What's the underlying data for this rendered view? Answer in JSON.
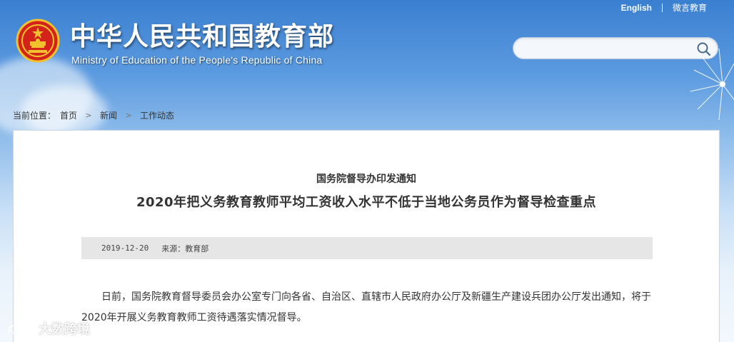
{
  "header": {
    "title": "中华人民共和国教育部",
    "subtitle": "Ministry of Education of the People's Republic of China",
    "links": {
      "english": "English",
      "weibo": "微言教育"
    },
    "search": {
      "placeholder": ""
    }
  },
  "breadcrumb": {
    "prefix": "当前位置：",
    "items": [
      "首页",
      "新闻",
      "工作动态"
    ]
  },
  "article": {
    "source": "国务院督导办印发通知",
    "title": "2020年把义务教育教师平均工资收入水平不低于当地公务员作为督导检查重点",
    "date": "2019-12-20",
    "origin": "来源：教育部",
    "paragraph": "日前，国务院教育督导委员会办公室专门向各省、自治区、直辖市人民政府办公厅及新疆生产建设兵团办公厅发出通知，将于2020年开展义务教育教师工资待遇落实情况督导。"
  },
  "watermark": {
    "text": "大数跨境"
  },
  "colors": {
    "sky_top": "#3a7fd0",
    "panel_bg": "#ffffff",
    "meta_bg": "#e6e6e6",
    "emblem_red": "#d4231a",
    "emblem_gold": "#f2c12e"
  }
}
